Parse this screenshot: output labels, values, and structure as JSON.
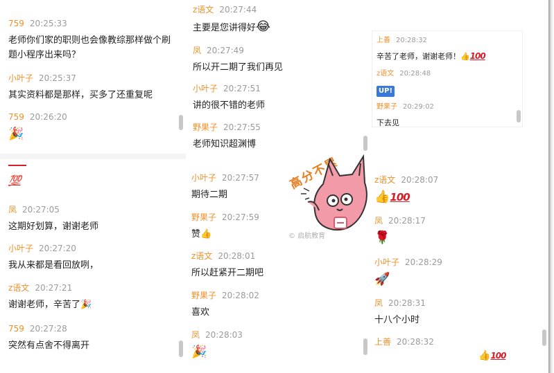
{
  "col1": {
    "messages": [
      {
        "user": "759",
        "time": "20:25:33",
        "text": "老师你们家的职则也会像教综那样做个刷"
      },
      {
        "text2": "题小程序出来吗？"
      },
      {
        "user": "小叶子",
        "time": "20:25:37",
        "text": "其实资料都是那样，买多了还重复呢"
      },
      {
        "user": "759",
        "time": "20:26:20",
        "emoji": "🎉"
      },
      {
        "emoji": "💯"
      },
      {
        "user": "凤",
        "time": "20:27:05",
        "text": "这期好划算，谢谢老师"
      },
      {
        "user": "小叶子",
        "time": "20:27:20",
        "text": "我从来都是看回放咧，"
      },
      {
        "user": "z语文",
        "time": "20:27:21",
        "text": "谢谢老师，辛苦了",
        "emoji": "🎉"
      },
      {
        "user": "759",
        "time": "20:27:28",
        "text": "突然有点舍不得离开"
      }
    ]
  },
  "col2": {
    "messages": [
      {
        "user": "z语文",
        "time": "20:27:44",
        "text": "主要是您讲得好",
        "emoji": "😂"
      },
      {
        "user": "凤",
        "time": "20:27:49",
        "text": "所以开二期了我们再见"
      },
      {
        "user": "小叶子",
        "time": "20:27:51",
        "text": "讲的很不错的老师"
      },
      {
        "user": "野果子",
        "time": "20:27:55",
        "text": "老师知识超渊博"
      },
      {
        "user": "小叶子",
        "time": "20:27:57",
        "text": "期待二期"
      },
      {
        "user": "野果子",
        "time": "20:27:59",
        "text": "赞",
        "emoji": "👍"
      },
      {
        "user": "z语文",
        "time": "20:28:01",
        "text": "所以赶紧开二期吧"
      },
      {
        "user": "野果子",
        "time": "20:28:02",
        "text": "喜欢"
      },
      {
        "user": "凤",
        "time": "20:28:03",
        "emoji": "🎉"
      }
    ]
  },
  "col3": {
    "messages": [
      {
        "user": "上善",
        "time": "20:28:32",
        "text": "辛苦了老师，谢谢老师！",
        "emoji": "👍",
        "hundred": "100"
      },
      {
        "user": "z语文",
        "time": "20:28:48",
        "badge": "UP!"
      },
      {
        "user": "野果子",
        "time": "20:29:02",
        "text": "下去见"
      },
      {
        "user": "z语文",
        "time": "20:28:07",
        "emoji": "👍",
        "hundred": "100"
      },
      {
        "user": "凤",
        "time": "20:28:17",
        "emoji": "🌹"
      },
      {
        "user": "小叶子",
        "time": "20:28:29",
        "emoji": "🚀"
      },
      {
        "user": "凤",
        "time": "20:28:31",
        "text": "十八个小时"
      },
      {
        "user": "上善",
        "time": "20:28:32",
        "emoji": "👍",
        "hundred": "100"
      }
    ]
  },
  "sticker": {
    "caption": "高分不累",
    "watermark": "© 启航教育"
  },
  "colors": {
    "user": "#f0902a",
    "time": "#9a9a9a",
    "hundred": "#d61e2a",
    "badge": "#3b78d8"
  }
}
